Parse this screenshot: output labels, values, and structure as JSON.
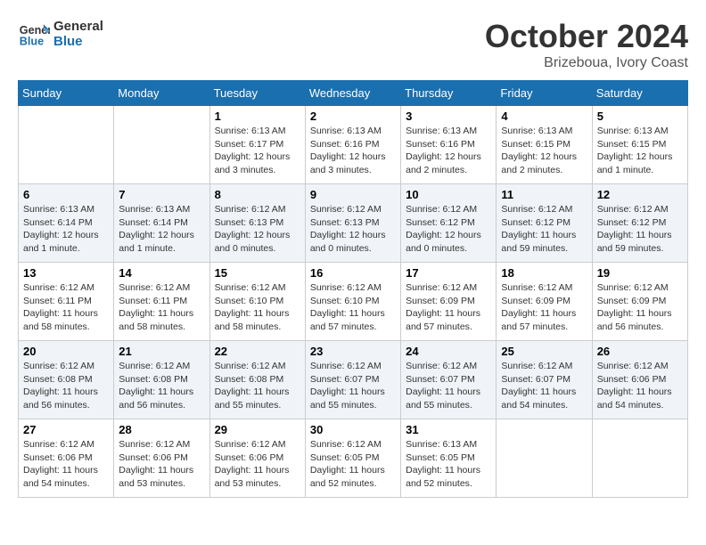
{
  "header": {
    "logo_line1": "General",
    "logo_line2": "Blue",
    "month_title": "October 2024",
    "subtitle": "Brizeboua, Ivory Coast"
  },
  "days_of_week": [
    "Sunday",
    "Monday",
    "Tuesday",
    "Wednesday",
    "Thursday",
    "Friday",
    "Saturday"
  ],
  "weeks": [
    [
      {
        "day": "",
        "info": ""
      },
      {
        "day": "",
        "info": ""
      },
      {
        "day": "1",
        "info": "Sunrise: 6:13 AM\nSunset: 6:17 PM\nDaylight: 12 hours and 3 minutes."
      },
      {
        "day": "2",
        "info": "Sunrise: 6:13 AM\nSunset: 6:16 PM\nDaylight: 12 hours and 3 minutes."
      },
      {
        "day": "3",
        "info": "Sunrise: 6:13 AM\nSunset: 6:16 PM\nDaylight: 12 hours and 2 minutes."
      },
      {
        "day": "4",
        "info": "Sunrise: 6:13 AM\nSunset: 6:15 PM\nDaylight: 12 hours and 2 minutes."
      },
      {
        "day": "5",
        "info": "Sunrise: 6:13 AM\nSunset: 6:15 PM\nDaylight: 12 hours and 1 minute."
      }
    ],
    [
      {
        "day": "6",
        "info": "Sunrise: 6:13 AM\nSunset: 6:14 PM\nDaylight: 12 hours and 1 minute."
      },
      {
        "day": "7",
        "info": "Sunrise: 6:13 AM\nSunset: 6:14 PM\nDaylight: 12 hours and 1 minute."
      },
      {
        "day": "8",
        "info": "Sunrise: 6:12 AM\nSunset: 6:13 PM\nDaylight: 12 hours and 0 minutes."
      },
      {
        "day": "9",
        "info": "Sunrise: 6:12 AM\nSunset: 6:13 PM\nDaylight: 12 hours and 0 minutes."
      },
      {
        "day": "10",
        "info": "Sunrise: 6:12 AM\nSunset: 6:12 PM\nDaylight: 12 hours and 0 minutes."
      },
      {
        "day": "11",
        "info": "Sunrise: 6:12 AM\nSunset: 6:12 PM\nDaylight: 11 hours and 59 minutes."
      },
      {
        "day": "12",
        "info": "Sunrise: 6:12 AM\nSunset: 6:12 PM\nDaylight: 11 hours and 59 minutes."
      }
    ],
    [
      {
        "day": "13",
        "info": "Sunrise: 6:12 AM\nSunset: 6:11 PM\nDaylight: 11 hours and 58 minutes."
      },
      {
        "day": "14",
        "info": "Sunrise: 6:12 AM\nSunset: 6:11 PM\nDaylight: 11 hours and 58 minutes."
      },
      {
        "day": "15",
        "info": "Sunrise: 6:12 AM\nSunset: 6:10 PM\nDaylight: 11 hours and 58 minutes."
      },
      {
        "day": "16",
        "info": "Sunrise: 6:12 AM\nSunset: 6:10 PM\nDaylight: 11 hours and 57 minutes."
      },
      {
        "day": "17",
        "info": "Sunrise: 6:12 AM\nSunset: 6:09 PM\nDaylight: 11 hours and 57 minutes."
      },
      {
        "day": "18",
        "info": "Sunrise: 6:12 AM\nSunset: 6:09 PM\nDaylight: 11 hours and 57 minutes."
      },
      {
        "day": "19",
        "info": "Sunrise: 6:12 AM\nSunset: 6:09 PM\nDaylight: 11 hours and 56 minutes."
      }
    ],
    [
      {
        "day": "20",
        "info": "Sunrise: 6:12 AM\nSunset: 6:08 PM\nDaylight: 11 hours and 56 minutes."
      },
      {
        "day": "21",
        "info": "Sunrise: 6:12 AM\nSunset: 6:08 PM\nDaylight: 11 hours and 56 minutes."
      },
      {
        "day": "22",
        "info": "Sunrise: 6:12 AM\nSunset: 6:08 PM\nDaylight: 11 hours and 55 minutes."
      },
      {
        "day": "23",
        "info": "Sunrise: 6:12 AM\nSunset: 6:07 PM\nDaylight: 11 hours and 55 minutes."
      },
      {
        "day": "24",
        "info": "Sunrise: 6:12 AM\nSunset: 6:07 PM\nDaylight: 11 hours and 55 minutes."
      },
      {
        "day": "25",
        "info": "Sunrise: 6:12 AM\nSunset: 6:07 PM\nDaylight: 11 hours and 54 minutes."
      },
      {
        "day": "26",
        "info": "Sunrise: 6:12 AM\nSunset: 6:06 PM\nDaylight: 11 hours and 54 minutes."
      }
    ],
    [
      {
        "day": "27",
        "info": "Sunrise: 6:12 AM\nSunset: 6:06 PM\nDaylight: 11 hours and 54 minutes."
      },
      {
        "day": "28",
        "info": "Sunrise: 6:12 AM\nSunset: 6:06 PM\nDaylight: 11 hours and 53 minutes."
      },
      {
        "day": "29",
        "info": "Sunrise: 6:12 AM\nSunset: 6:06 PM\nDaylight: 11 hours and 53 minutes."
      },
      {
        "day": "30",
        "info": "Sunrise: 6:12 AM\nSunset: 6:05 PM\nDaylight: 11 hours and 52 minutes."
      },
      {
        "day": "31",
        "info": "Sunrise: 6:13 AM\nSunset: 6:05 PM\nDaylight: 11 hours and 52 minutes."
      },
      {
        "day": "",
        "info": ""
      },
      {
        "day": "",
        "info": ""
      }
    ]
  ]
}
